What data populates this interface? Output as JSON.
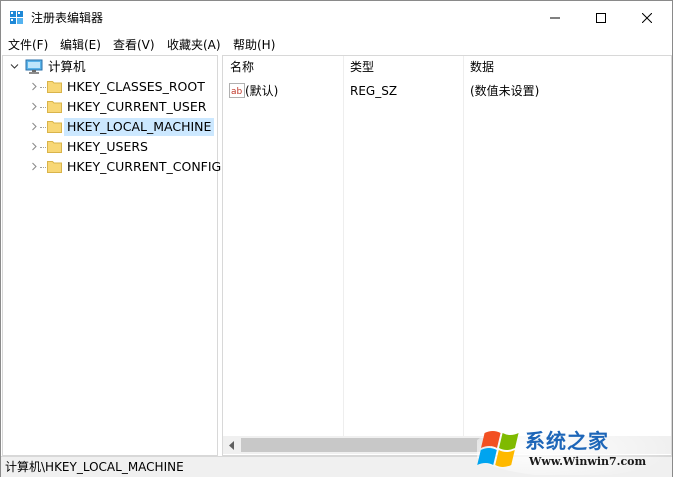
{
  "window": {
    "title": "注册表编辑器"
  },
  "menubar": {
    "items": [
      {
        "label": "文件(F)"
      },
      {
        "label": "编辑(E)"
      },
      {
        "label": "查看(V)"
      },
      {
        "label": "收藏夹(A)"
      },
      {
        "label": "帮助(H)"
      }
    ]
  },
  "tree": {
    "root_label": "计算机",
    "items": [
      {
        "label": "HKEY_CLASSES_ROOT"
      },
      {
        "label": "HKEY_CURRENT_USER"
      },
      {
        "label": "HKEY_LOCAL_MACHINE"
      },
      {
        "label": "HKEY_USERS"
      },
      {
        "label": "HKEY_CURRENT_CONFIG"
      }
    ]
  },
  "list": {
    "columns": [
      "名称",
      "类型",
      "数据"
    ],
    "rows": [
      {
        "name": "(默认)",
        "type": "REG_SZ",
        "data": "(数值未设置)"
      }
    ]
  },
  "statusbar": {
    "path": "计算机\\HKEY_LOCAL_MACHINE"
  },
  "watermark": {
    "brand": "系统之家",
    "url": "Www.Winwin7.com"
  },
  "colors": {
    "selection": "#cce8ff",
    "folder": "#f8d775",
    "accent": "#0078d7"
  }
}
